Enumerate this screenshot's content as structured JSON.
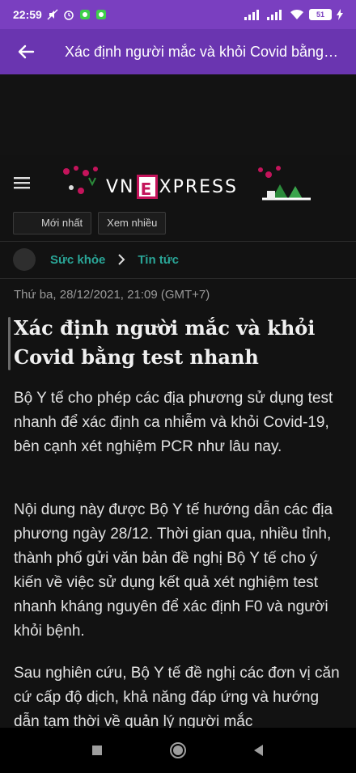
{
  "status_bar": {
    "time": "22:59",
    "battery": "51"
  },
  "app_bar": {
    "title": "Xác định người mắc và khỏi Covid bằng ..."
  },
  "brand": {
    "logo_left": "VN",
    "logo_mid": "E",
    "logo_right": "XPRESS"
  },
  "filters": [
    {
      "label": "Mới nhất"
    },
    {
      "label": "Xem nhiều"
    }
  ],
  "breadcrumb": {
    "section": "Sức khỏe",
    "subsection": "Tin tức"
  },
  "article": {
    "date": "Thứ ba, 28/12/2021, 21:09 (GMT+7)",
    "headline": "Xác định người mắc và khỏi Covid bằng test nhanh",
    "paragraphs": [
      "Bộ Y tế cho phép các địa phương sử dụng test nhanh để xác định ca nhiễm và khỏi Covid-19, bên cạnh xét nghiệm PCR như lâu nay.",
      "Nội dung này được Bộ Y tế hướng dẫn các địa phương ngày 28/12. Thời gian qua, nhiều tỉnh, thành phố gửi văn bản đề nghị Bộ Y tế cho ý kiến về việc sử dụng kết quả xét nghiệm test nhanh kháng nguyên để xác định F0 và người khỏi bệnh.",
      "Sau nghiên cứu, Bộ Y tế đề nghị các đơn vị căn cứ cấp độ dịch, khả năng đáp ứng và hướng dẫn tạm thời về quản lý người mắc"
    ]
  },
  "colors": {
    "status_bar": "#7a3fc0",
    "app_bar": "#6a35b0",
    "accent_link": "#2aa597",
    "brand_e": "#c4145b"
  },
  "icons": {
    "back": "arrow-left-icon",
    "menu": "hamburger-icon",
    "home": "circle-icon",
    "recents": "square-icon",
    "nav_back": "triangle-left-icon"
  }
}
